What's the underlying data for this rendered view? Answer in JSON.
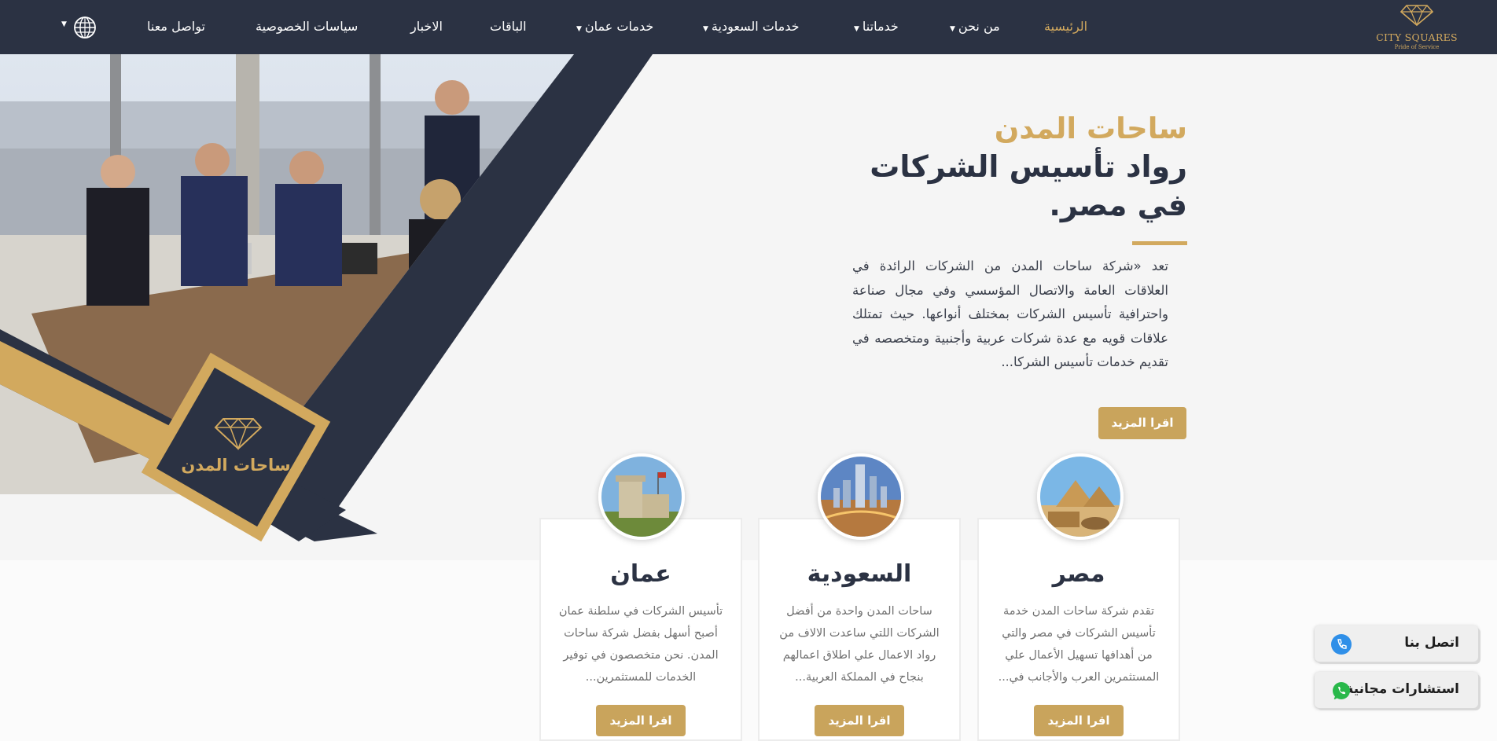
{
  "brand": {
    "logo_title": "CITY SQUARES",
    "logo_tagline": "Pride of Service",
    "badge_text": "ساحات المدن",
    "accent_color": "#d2a95e",
    "navy_color": "#2b3243"
  },
  "nav": {
    "items": [
      {
        "label": "الرئيسية",
        "active": true
      },
      {
        "label": "من نحن",
        "dropdown": true
      },
      {
        "label": "خدماتنا",
        "dropdown": true
      },
      {
        "label": "خدمات السعودية",
        "dropdown": true
      },
      {
        "label": "خدمات عمان",
        "dropdown": true
      },
      {
        "label": "الباقات"
      },
      {
        "label": "الاخبار"
      },
      {
        "label": "سياسات الخصوصية"
      },
      {
        "label": "تواصل معنا"
      }
    ],
    "language_icon": "globe-icon"
  },
  "hero": {
    "title_line1": "ساحات المدن",
    "title_line2": "رواد تأسيس الشركات في مصر.",
    "paragraph": "تعد «شركة ساحات المدن من الشركات الرائدة في العلاقات العامة والاتصال المؤسسي وفي مجال صناعة واحترافية تأسيس الشركات بمختلف أنواعها. حيث تمتلك علاقات قويه مع عدة شركات عربية وأجنبية ومتخصصه في تقديم خدمات تأسيس الشركا...",
    "read_more": "اقرا المزيد"
  },
  "cards": [
    {
      "title": "مصر",
      "text": "تقدم شركة ساحات المدن خدمة تأسيس الشركات في مصر والتي من أهدافها تسهيل الأعمال علي المستثمرين العرب والأجانب في...",
      "button": "اقرا المزيد",
      "image": "pyramids-photo"
    },
    {
      "title": "السعودية",
      "text": "ساحات المدن واحدة من أفضل الشركات اللتي ساعدت الالاف من رواد الاعمال علي اطلاق اعمالهم بنجاح في المملكة العربية...",
      "button": "اقرا المزيد",
      "image": "riyadh-skyline-photo"
    },
    {
      "title": "عمان",
      "text": "تأسيس الشركات في سلطنة عمان أصبح أسهل بفضل شركة ساحات المدن. نحن متخصصون في توفير الخدمات للمستثمرين...",
      "button": "اقرا المزيد",
      "image": "oman-fort-photo"
    }
  ],
  "floating": {
    "contact_label": "اتصل بنا",
    "contact_icon": "phone-icon",
    "consult_label": "استشارات مجانية",
    "consult_icon": "whatsapp-icon"
  }
}
